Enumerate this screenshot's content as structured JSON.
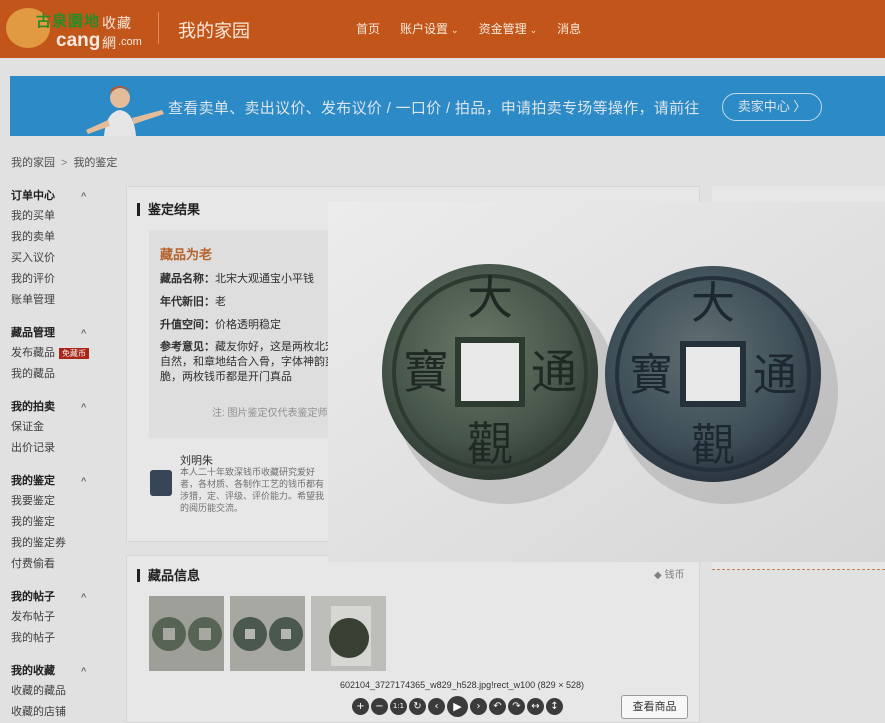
{
  "header": {
    "logo_brand": "古泉園地",
    "logo_cn": "收藏網",
    "logo_en": "cang",
    "logo_com": ".com",
    "site_title": "我的家园",
    "nav": [
      {
        "label": "首页",
        "has_dropdown": false
      },
      {
        "label": "账户设置",
        "has_dropdown": true
      },
      {
        "label": "资金管理",
        "has_dropdown": true
      },
      {
        "label": "消息",
        "has_dropdown": false
      }
    ]
  },
  "banner": {
    "text": "查看卖单、卖出议价、发布议价 / 一口价 / 拍品，申请拍卖专场等操作，请前往",
    "button": "卖家中心 〉"
  },
  "breadcrumb": [
    "我的家园",
    "我的鉴定"
  ],
  "sidebar": [
    {
      "title": "订单中心",
      "items": [
        {
          "label": "我的买单"
        },
        {
          "label": "我的卖单"
        },
        {
          "label": "买入议价"
        },
        {
          "label": "我的评价"
        },
        {
          "label": "账单管理"
        }
      ]
    },
    {
      "title": "藏品管理",
      "items": [
        {
          "label": "发布藏品",
          "badge": "免藏币"
        },
        {
          "label": "我的藏品"
        }
      ]
    },
    {
      "title": "我的拍卖",
      "items": [
        {
          "label": "保证金"
        },
        {
          "label": "出价记录"
        }
      ]
    },
    {
      "title": "我的鉴定",
      "items": [
        {
          "label": "我要鉴定"
        },
        {
          "label": "我的鉴定"
        },
        {
          "label": "我的鉴定券"
        },
        {
          "label": "付费偷看"
        }
      ]
    },
    {
      "title": "我的帖子",
      "items": [
        {
          "label": "发布帖子"
        },
        {
          "label": "我的帖子"
        }
      ]
    },
    {
      "title": "我的收藏",
      "items": [
        {
          "label": "收藏的藏品"
        },
        {
          "label": "收藏的店铺"
        }
      ]
    }
  ],
  "result": {
    "section_title": "鉴定结果",
    "verdict": "藏品为老",
    "fields": [
      {
        "label": "藏品名称：",
        "value": "北宋大观通宝小平钱"
      },
      {
        "label": "年代新旧：",
        "value": "老"
      },
      {
        "label": "升值空间：",
        "value": "价格透明稳定"
      },
      {
        "label": "参考意见：",
        "value": "藏友你好，这是两枚北宋"
      }
    ],
    "opinion_more": [
      "自然，和章地结合入骨，字体神韵爽",
      "脆，两枚钱币都是开门真品"
    ],
    "note": "注: 图片鉴定仅代表鉴定师"
  },
  "expert": {
    "name": "刘明朱",
    "bio": "本人二十年致深钱币收藏研究爱好者，各材质、各制作工艺的钱币都有涉猎，定、评级、评价能力。希望我的阅历能交流。"
  },
  "info": {
    "section_title": "藏品信息",
    "tag": "钱币"
  },
  "lightbox": {
    "caption": "602104_3727174365_w829_h528.jpg!rect_w100 (829 × 528)",
    "coin_chars": [
      "大",
      "通",
      "觀",
      "寶"
    ],
    "tools": [
      "+",
      "−",
      "1:1",
      "↻",
      "‹",
      "▶",
      "›",
      "↶",
      "↷",
      "↔",
      "↕"
    ],
    "view_button": "查看商品"
  },
  "colors": {
    "header_bg": "#c2561a",
    "banner_bg": "#2f93d3",
    "verdict": "#c26a2f",
    "badge": "#b52a1a"
  }
}
